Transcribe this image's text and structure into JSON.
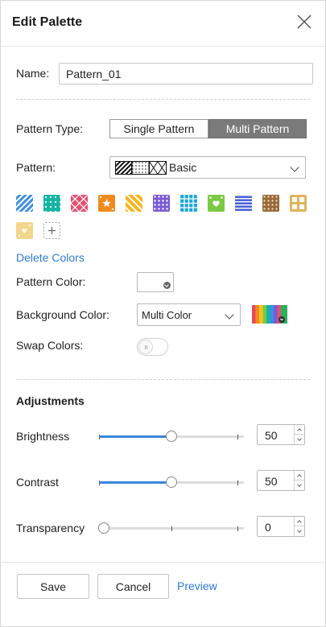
{
  "header": {
    "title": "Edit Palette",
    "close_icon": "close-icon"
  },
  "form": {
    "name_label": "Name:",
    "name_value": "Pattern_01",
    "pattern_type_label": "Pattern Type:",
    "pattern_type_options": [
      "Single Pattern",
      "Multi Pattern"
    ],
    "pattern_type_selected": "Multi Pattern",
    "pattern_label": "Pattern:",
    "pattern_value": "Basic",
    "swatches": [
      {
        "name": "diagonal-stripes",
        "color": "#3b8fe0"
      },
      {
        "name": "polka-dots",
        "color": "#15b5a4"
      },
      {
        "name": "diamond-lattice",
        "color": "#e0516f"
      },
      {
        "name": "stars",
        "color": "#f08a1c"
      },
      {
        "name": "wide-diagonal-stripes",
        "color": "#f5b51f"
      },
      {
        "name": "dot-grid",
        "color": "#7a59d6"
      },
      {
        "name": "square-grid",
        "color": "#1ea7d6"
      },
      {
        "name": "hearts",
        "color": "#7ac943"
      },
      {
        "name": "horizontal-stripes",
        "color": "#4a62d6"
      },
      {
        "name": "brown-dots",
        "color": "#9a6a3a"
      },
      {
        "name": "tan-grid",
        "color": "#e0b45a"
      },
      {
        "name": "cream-hearts",
        "color": "#f2d78a"
      }
    ],
    "add_swatch_icon": "plus-icon",
    "delete_colors_label": "Delete Colors",
    "pattern_color_label": "Pattern Color:",
    "background_color_label": "Background Color:",
    "background_color_value": "Multi Color",
    "swap_colors_label": "Swap Colors:",
    "swap_colors_on": false
  },
  "adjustments": {
    "title": "Adjustments",
    "brightness": {
      "label": "Brightness",
      "value": "50",
      "fraction": 0.5
    },
    "contrast": {
      "label": "Contrast",
      "value": "50",
      "fraction": 0.5
    },
    "transparency": {
      "label": "Transparency",
      "value": "0",
      "fraction": 0.0
    }
  },
  "footer": {
    "save_label": "Save",
    "cancel_label": "Cancel",
    "preview_label": "Preview"
  }
}
